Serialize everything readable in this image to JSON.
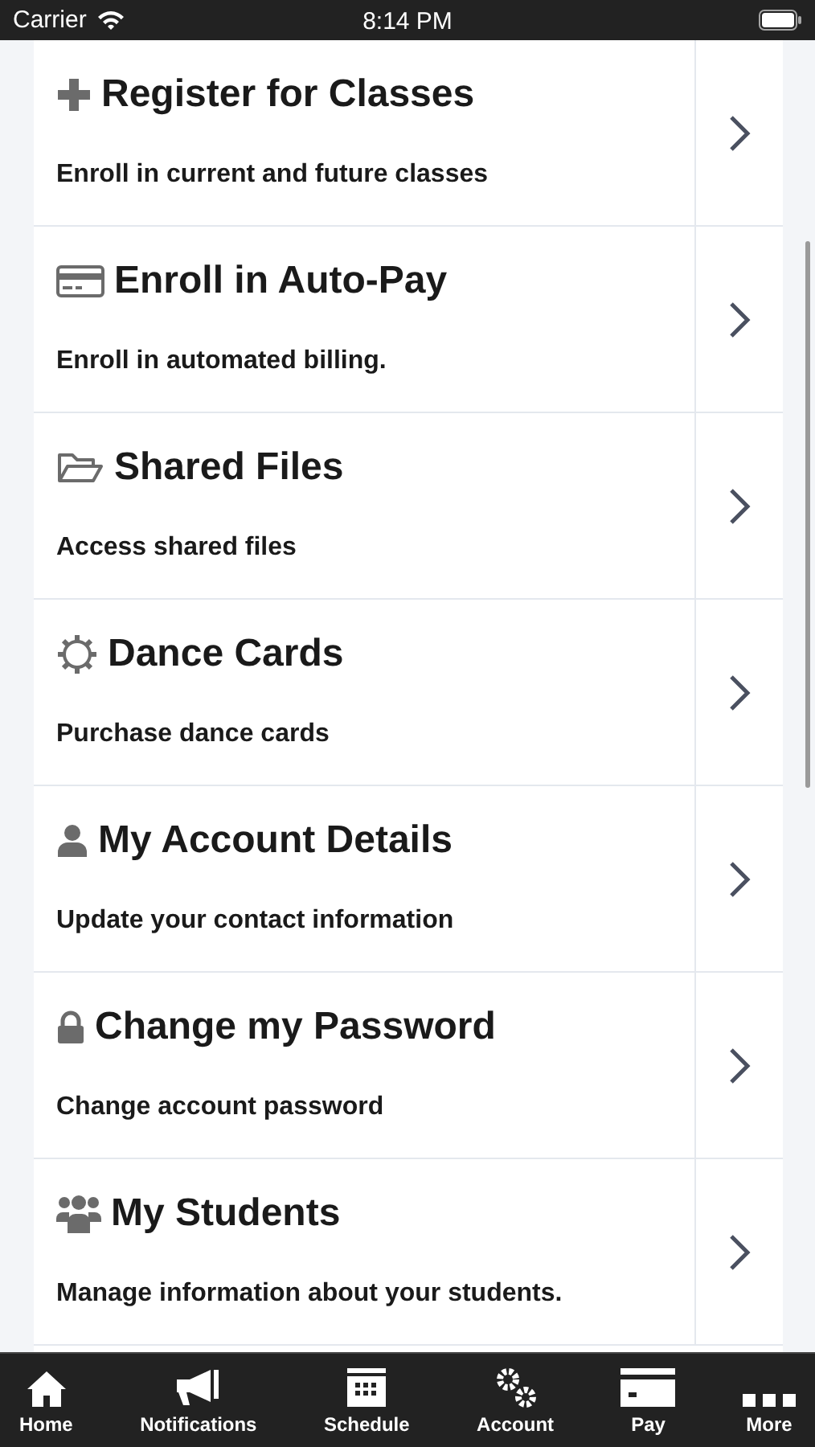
{
  "status_bar": {
    "carrier": "Carrier",
    "time": "8:14 PM"
  },
  "menu_items": [
    {
      "title": "Register for Classes",
      "subtitle": "Enroll in current and future classes"
    },
    {
      "title": "Enroll in Auto-Pay",
      "subtitle": "Enroll in automated billing."
    },
    {
      "title": "Shared Files",
      "subtitle": "Access shared files"
    },
    {
      "title": "Dance Cards",
      "subtitle": "Purchase dance cards"
    },
    {
      "title": "My Account Details",
      "subtitle": "Update your contact information"
    },
    {
      "title": "Change my Password",
      "subtitle": "Change account password"
    },
    {
      "title": "My Students",
      "subtitle": "Manage information about your students."
    }
  ],
  "tab_bar": [
    {
      "label": "Home"
    },
    {
      "label": "Notifications"
    },
    {
      "label": "Schedule"
    },
    {
      "label": "Account"
    },
    {
      "label": "Pay"
    },
    {
      "label": "More"
    }
  ]
}
